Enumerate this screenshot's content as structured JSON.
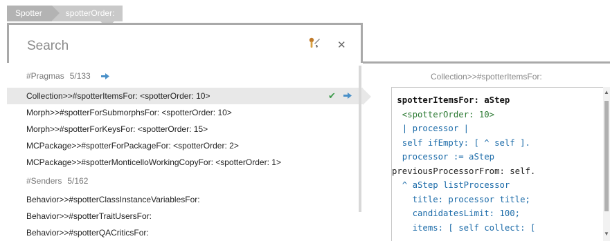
{
  "breadcrumb": {
    "items": [
      "Spotter",
      "spotterOrder:"
    ]
  },
  "search": {
    "placeholder": "Search"
  },
  "groups": [
    {
      "name": "#Pragmas",
      "count": "5/133"
    },
    {
      "name": "#Senders",
      "count": "5/162"
    }
  ],
  "pragmas": [
    "Collection>>#spotterItemsFor: <spotterOrder: 10>",
    "Morph>>#spotterForSubmorphsFor: <spotterOrder: 10>",
    "Morph>>#spotterForKeysFor: <spotterOrder: 15>",
    "MCPackage>>#spotterForPackageFor: <spotterOrder: 2>",
    "MCPackage>>#spotterMonticelloWorkingCopyFor: <spotterOrder: 1>"
  ],
  "senders": [
    "Behavior>>#spotterClassInstanceVariablesFor:",
    "Behavior>>#spotterTraitUsersFor:",
    "Behavior>>#spotterQACriticsFor:"
  ],
  "selected_index": 0,
  "preview": {
    "title": "Collection>>#spotterItemsFor:",
    "code_lines": [
      "spotterItemsFor: aStep",
      "  <spotterOrder: 10>",
      "  | processor |",
      "  self ifEmpty: [ ^ self ].",
      "  processor := aStep",
      "previousProcessorFrom: self.",
      "  ^ aStep listProcessor",
      "    title: processor title;",
      "    candidatesLimit: 100;",
      "    items: [ self collect: ["
    ]
  },
  "colors": {
    "accent": "#4a90c8",
    "check": "#3b9a4a",
    "selected_bg": "#e8e8e8",
    "border": "#a9a9a9"
  }
}
